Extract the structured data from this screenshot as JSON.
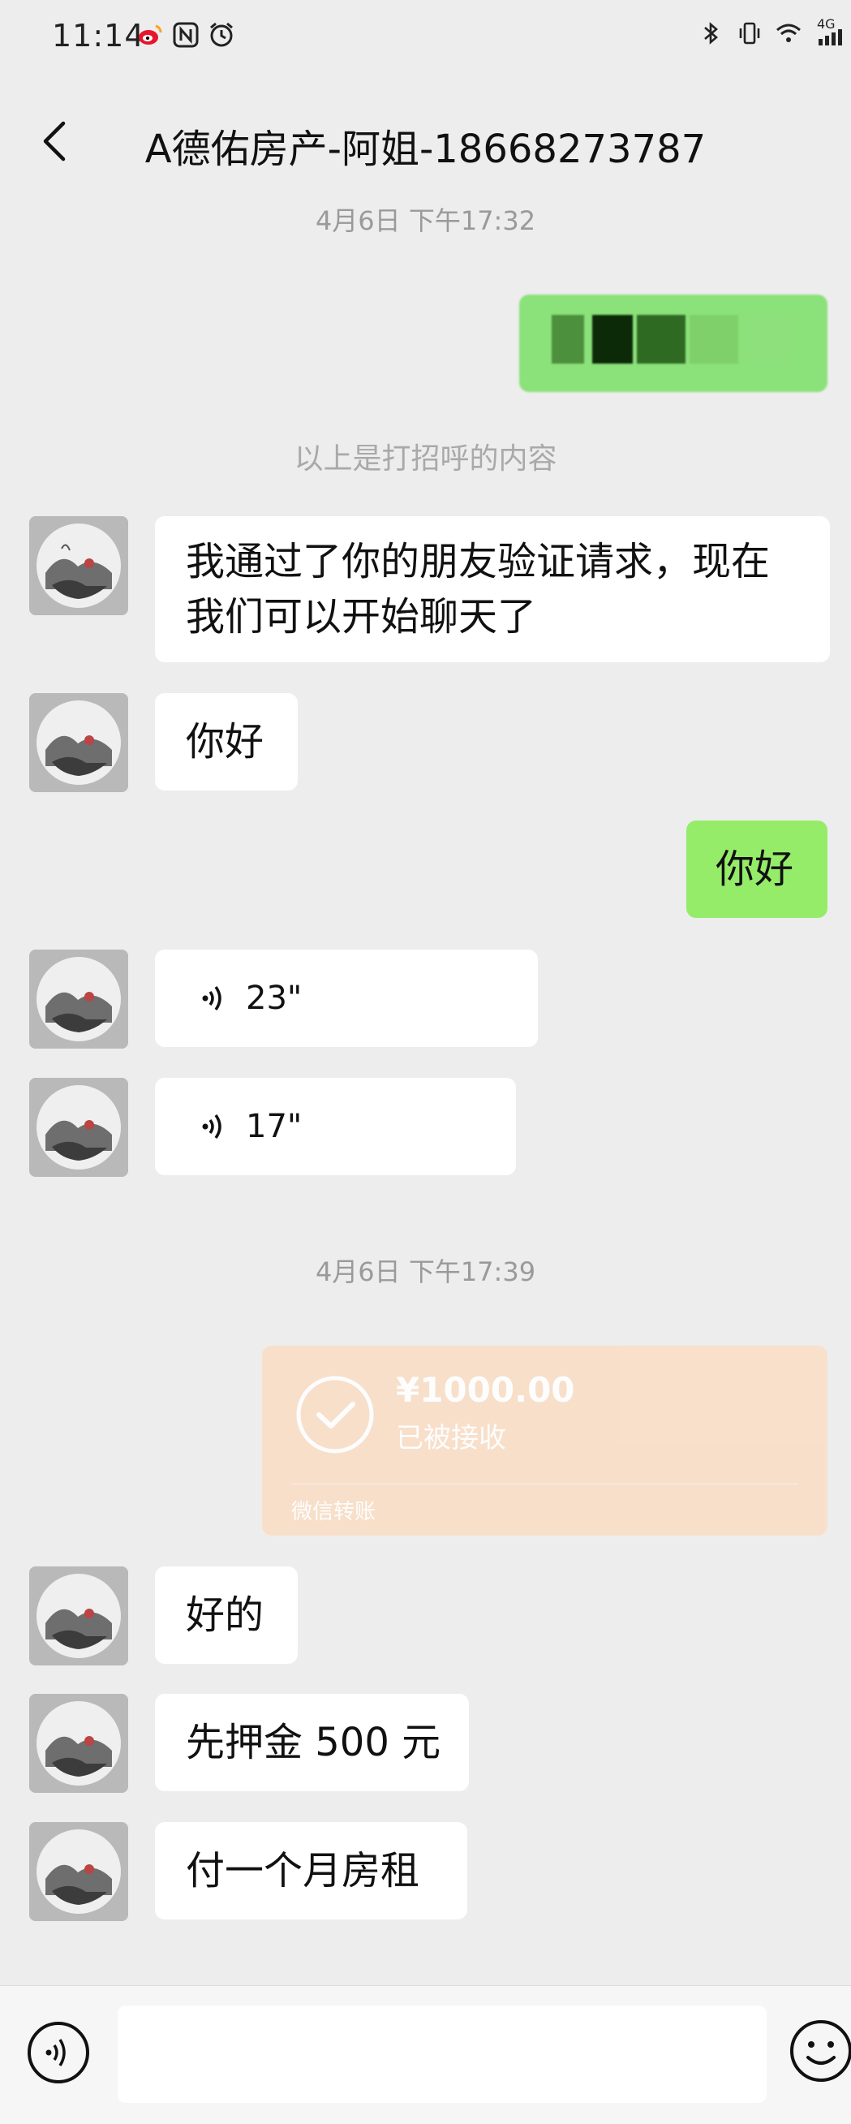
{
  "status": {
    "time": "11:14",
    "network": "4G",
    "icons_left": [
      "weibo-icon",
      "nfc-icon",
      "alarm-icon"
    ],
    "icons_right": [
      "bluetooth-icon",
      "vibrate-icon",
      "wifi-icon",
      "signal-icon"
    ]
  },
  "header": {
    "title": "A德佑房产-阿姐-18668273787"
  },
  "chat": {
    "timestamp_1": "4月6日 下午17:32",
    "greeting_notice": "以上是打招呼的内容",
    "msg_verify_line1": "我通过了你的朋友验证请求，现在",
    "msg_verify_line2": "我们可以开始聊天了",
    "msg_hello_in": "你好",
    "msg_hello_out": "你好",
    "voice_1_duration": "23\"",
    "voice_2_duration": "17\"",
    "timestamp_2": "4月6日 下午17:39",
    "transfer": {
      "amount": "¥1000.00",
      "status": "已被接收",
      "footer": "微信转账"
    },
    "msg_ok": "好的",
    "msg_deposit": "先押金 500 元",
    "msg_rent": "付一个月房租"
  },
  "colors": {
    "background": "#ededed",
    "incoming_bubble": "#ffffff",
    "outgoing_bubble": "#95ec69",
    "transfer_card": "#f9dec8"
  },
  "input": {
    "placeholder": ""
  }
}
